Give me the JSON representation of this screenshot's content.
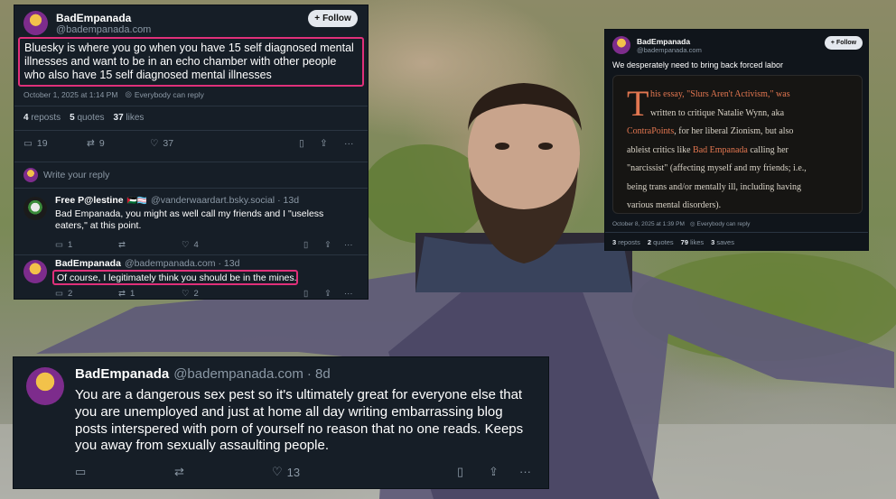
{
  "post_main": {
    "display_name": "BadEmpanada",
    "handle": "@badempanada.com",
    "follow_label": "Follow",
    "text": "Bluesky is where you go when you have 15 self diagnosed mental illnesses and want to be in an echo chamber with other people who also have 15 self diagnosed mental illnesses",
    "timestamp": "October 1, 2025 at 1:14 PM",
    "audience": "Everybody can reply",
    "stats": {
      "reposts_n": "4",
      "reposts_l": "reposts",
      "quotes_n": "5",
      "quotes_l": "quotes",
      "likes_n": "37",
      "likes_l": "likes"
    },
    "actions": {
      "replies": "19",
      "reposts": "9",
      "likes": "37"
    },
    "reply_placeholder": "Write your reply"
  },
  "reply_1": {
    "display_name": "Free P@lestine",
    "emojis": "🇵🇸🏳️‍⚧️",
    "handle": "@vanderwaardart.bsky.social",
    "age": "· 13d",
    "text": "Bad Empanada, you might as well call my friends and I \"useless eaters,\" at this point.",
    "actions": {
      "replies": "1",
      "reposts": "",
      "likes": "4"
    }
  },
  "reply_2": {
    "display_name": "BadEmpanada",
    "handle": "@badempanada.com",
    "age": "· 13d",
    "text": "Of course, I legitimately think you should be in the mines.",
    "actions": {
      "replies": "2",
      "reposts": "1",
      "likes": "2"
    }
  },
  "post_right": {
    "display_name": "BadEmpanada",
    "handle": "@badempanada.com",
    "follow_label": "Follow",
    "text": "We desperately need to bring back forced labor",
    "essay": {
      "dropcap": "T",
      "p1": "his essay, \"Slurs Aren't Activism,\" was",
      "p2": " written to critique Natalie Wynn, aka",
      "p3a": "ContraPoints",
      "p3b": ", for her liberal Zionism, but also",
      "p4a": "ableist critics like ",
      "p4b": "Bad Empanada",
      "p4c": " calling her",
      "p5": "\"narcissist\" (affecting myself and my friends; i.e.,",
      "p6": "being trans and/or mentally ill, including having",
      "p7": "various mental disorders)."
    },
    "timestamp": "October 8, 2025 at 1:39 PM",
    "audience": "Everybody can reply",
    "stats": {
      "reposts_n": "3",
      "reposts_l": "reposts",
      "quotes_n": "2",
      "quotes_l": "quotes",
      "likes_n": "79",
      "likes_l": "likes",
      "saves_n": "3",
      "saves_l": "saves"
    }
  },
  "post_bottom": {
    "display_name": "BadEmpanada",
    "handle": "@badempanada.com",
    "age": "· 8d",
    "text": "You are a dangerous sex pest so it's ultimately great for everyone else that you are unemployed and just at home all day writing embarrassing blog posts interspered with porn of yourself no reason that no one reads. Keeps you away from sexually assaulting people.",
    "actions": {
      "replies": "",
      "reposts": "",
      "likes": "13"
    }
  },
  "colors": {
    "highlight": "#e0307a",
    "essay_link": "#e27650",
    "panel_bg": "#161e27"
  },
  "icons": [
    "reply-icon",
    "repost-icon",
    "like-icon",
    "bookmark-icon",
    "share-icon",
    "more-icon",
    "globe-icon",
    "plus-icon"
  ]
}
